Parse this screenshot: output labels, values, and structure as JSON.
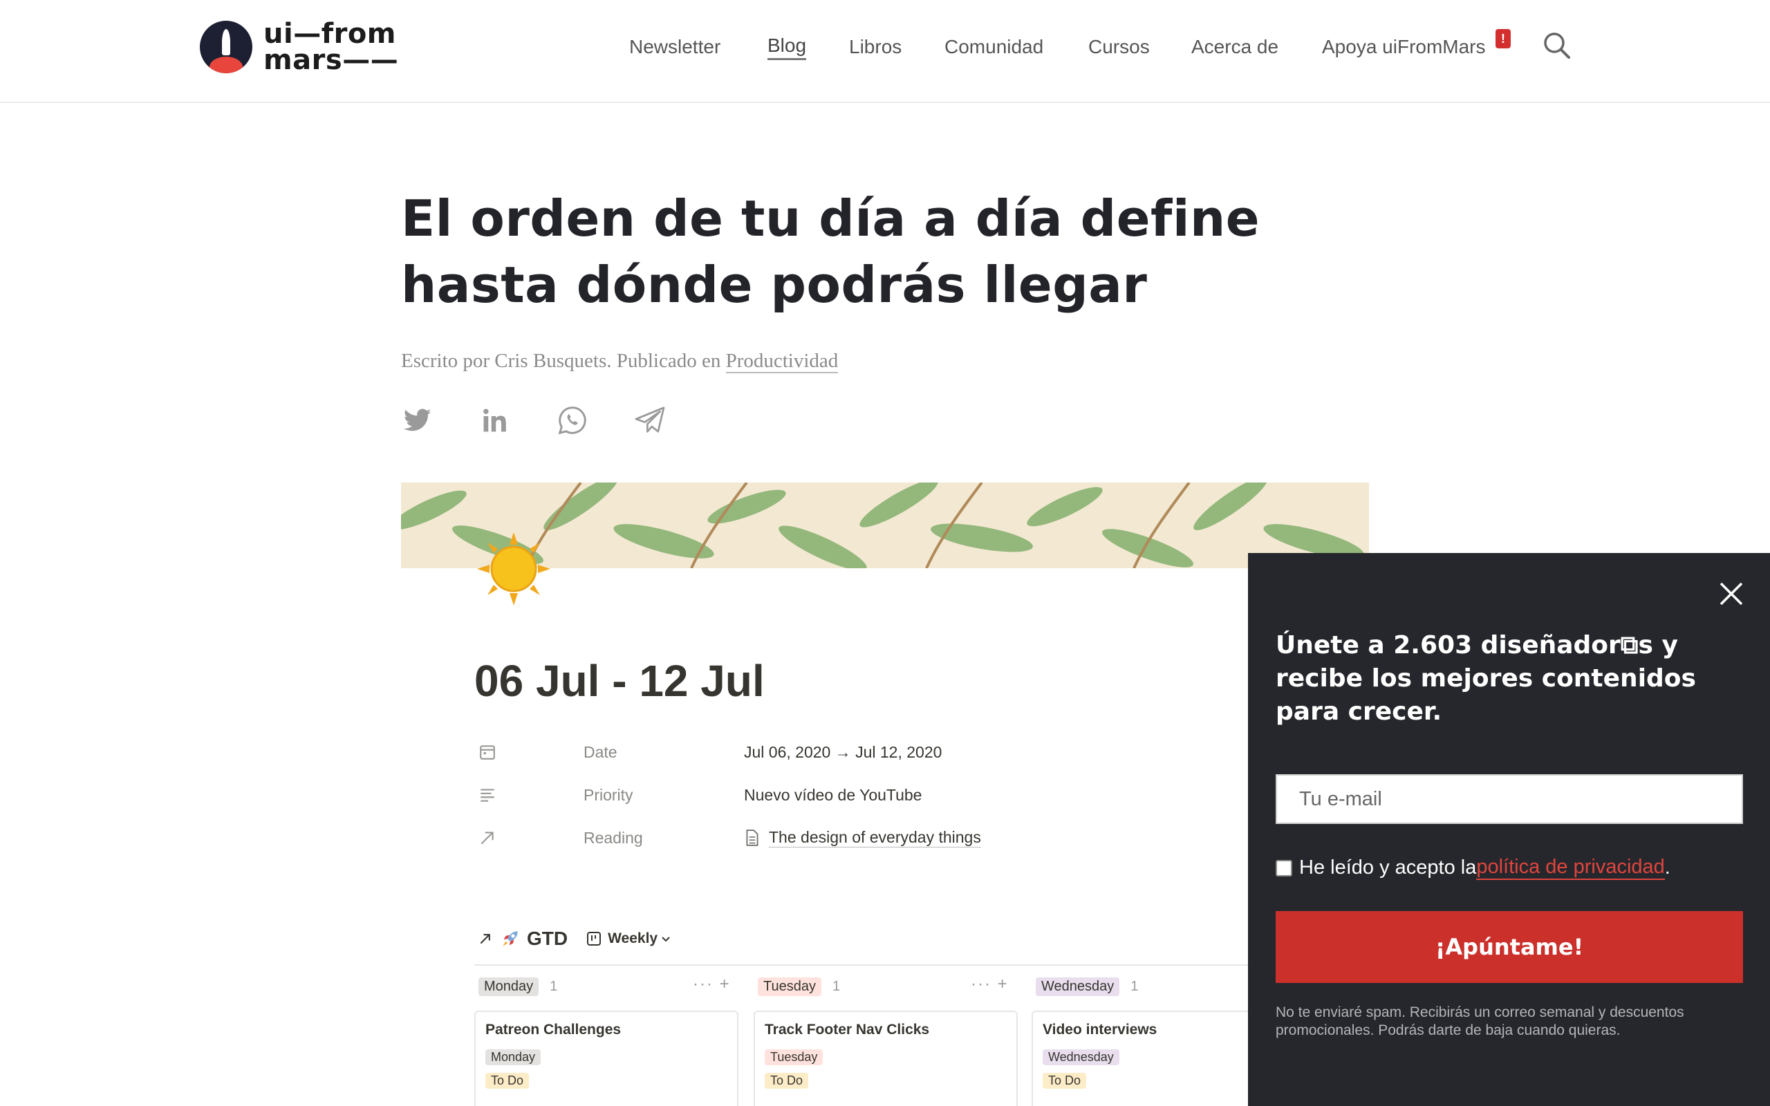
{
  "header": {
    "logo_line1": "ui—from",
    "logo_line2": "mars——",
    "nav": [
      {
        "label": "Newsletter"
      },
      {
        "label": "Blog",
        "active": true
      },
      {
        "label": "Libros"
      },
      {
        "label": "Comunidad"
      },
      {
        "label": "Cursos"
      },
      {
        "label": "Acerca de"
      },
      {
        "label": "Apoya uiFromMars"
      }
    ],
    "badge": "!"
  },
  "article": {
    "title": "El orden de tu día a día define hasta dónde podrás llegar",
    "byline_prefix": "Escrito por Cris Busquets. Publicado en ",
    "category": "Productividad"
  },
  "hero": {
    "week_title": "06 Jul - 12 Jul",
    "properties": [
      {
        "label": "Date",
        "value": "Jul 06, 2020 → Jul 12, 2020",
        "icon": "calendar-icon"
      },
      {
        "label": "Priority",
        "value": "Nuevo vídeo de YouTube",
        "icon": "text-lines-icon"
      },
      {
        "label": "Reading",
        "value": "The design of everyday things",
        "icon": "relation-arrow-icon"
      }
    ],
    "database": {
      "name": "GTD",
      "view": "Weekly"
    },
    "columns": [
      {
        "day": "Monday",
        "count": "1",
        "card_title": "Patreon Challenges",
        "status": "To Do",
        "tag_color": "#e3e2e0"
      },
      {
        "day": "Tuesday",
        "count": "1",
        "card_title": "Track Footer Nav Clicks",
        "status": "To Do",
        "tag_color": "#ffe2dd"
      },
      {
        "day": "Wednesday",
        "count": "1",
        "card_title": "Video interviews",
        "status": "To Do",
        "tag_color": "#e8deee"
      }
    ],
    "status_color": "#fdecc8"
  },
  "popup": {
    "title": "Únete a 2.603 diseñador⧉s y recibe los mejores contenidos para crecer.",
    "email_placeholder": "Tu e-mail",
    "consent_prefix": "He leído y acepto la ",
    "consent_link": "política de privacidad",
    "consent_suffix": ".",
    "submit": "¡Apúntame!",
    "fineprint": "No te enviaré spam. Recibirás un correo semanal y descuentos promocionales. Podrás darte de baja cuando quieras."
  },
  "colors": {
    "accent_red": "#cb302b",
    "popup_bg": "#26272c",
    "link_red": "#e0453d"
  }
}
